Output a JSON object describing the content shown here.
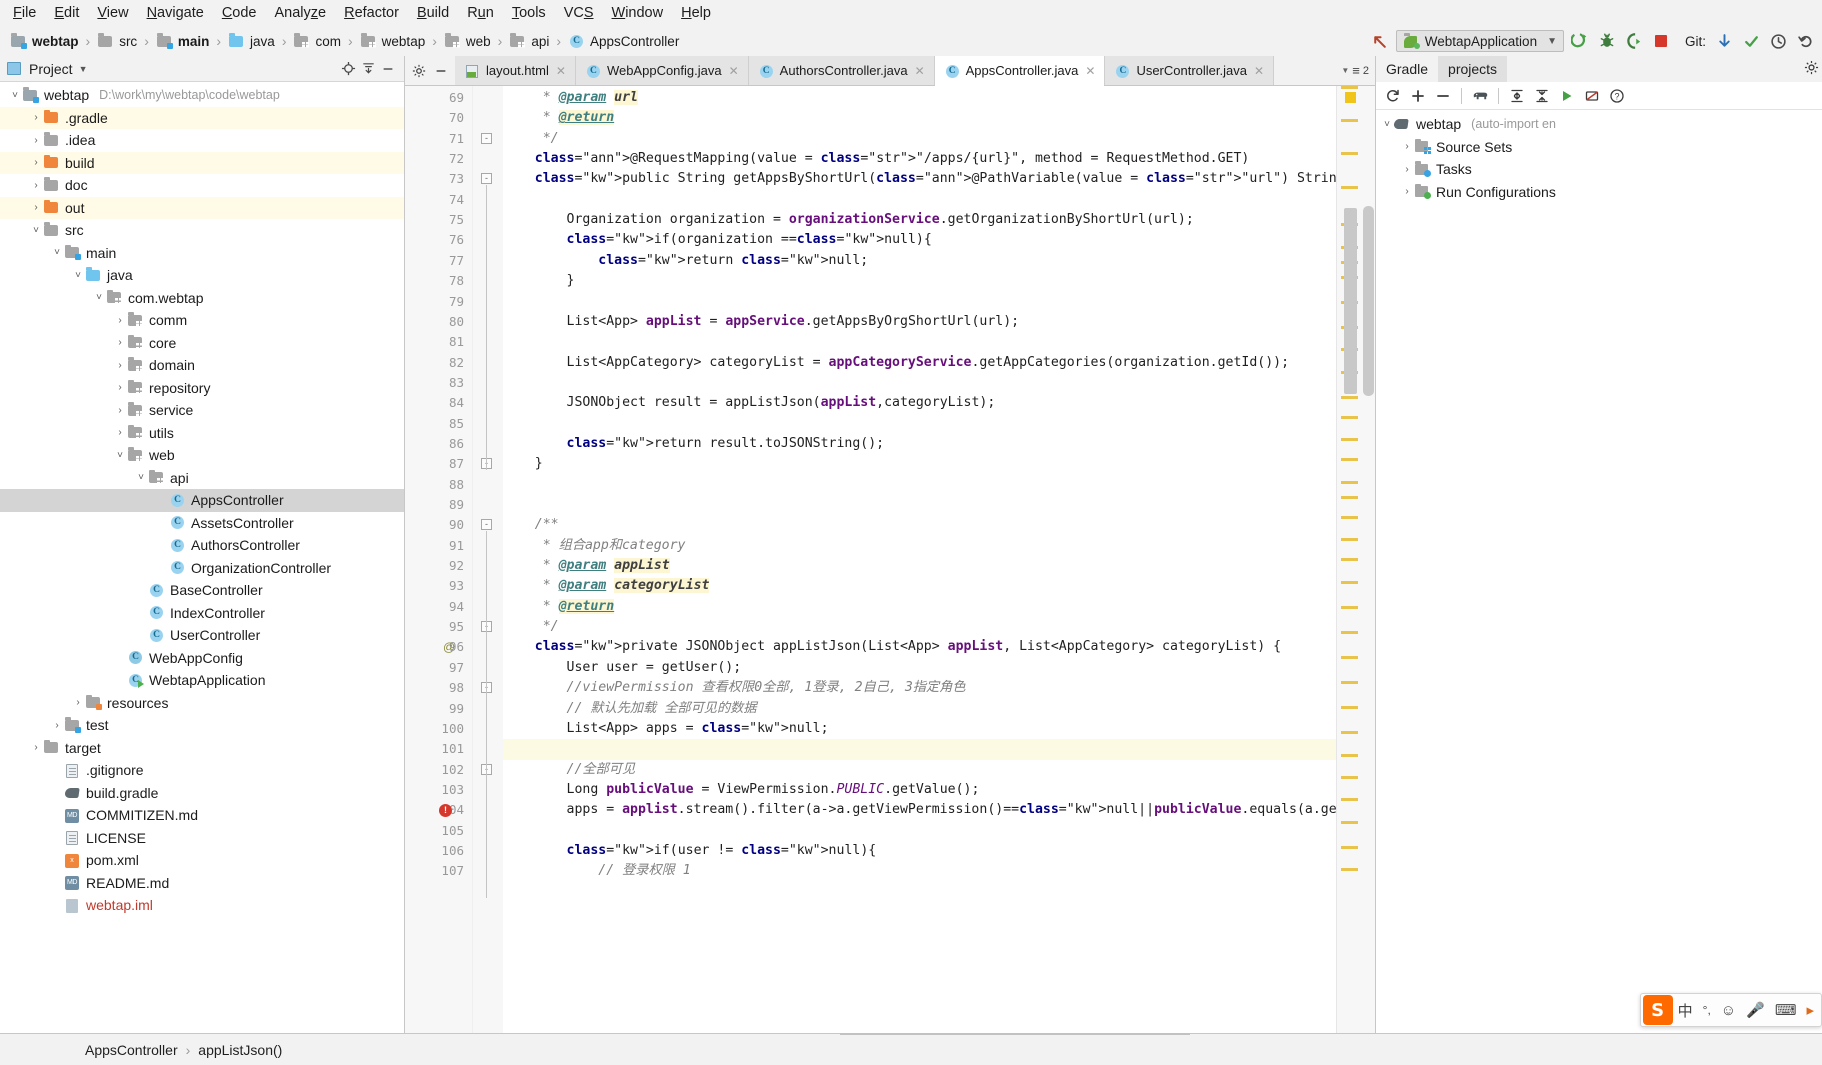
{
  "menu": {
    "items": [
      {
        "label": "File",
        "mnemonic": "F"
      },
      {
        "label": "Edit",
        "mnemonic": "E"
      },
      {
        "label": "View",
        "mnemonic": "V"
      },
      {
        "label": "Navigate",
        "mnemonic": "N"
      },
      {
        "label": "Code",
        "mnemonic": "C"
      },
      {
        "label": "Analyze",
        "mnemonic": "z"
      },
      {
        "label": "Refactor",
        "mnemonic": "R"
      },
      {
        "label": "Build",
        "mnemonic": "B"
      },
      {
        "label": "Run",
        "mnemonic": "u"
      },
      {
        "label": "Tools",
        "mnemonic": "T"
      },
      {
        "label": "VCS",
        "mnemonic": "S"
      },
      {
        "label": "Window",
        "mnemonic": "W"
      },
      {
        "label": "Help",
        "mnemonic": "H"
      }
    ]
  },
  "breadcrumb": {
    "items": [
      {
        "label": "webtap",
        "icon": "module-icon",
        "bold": true
      },
      {
        "label": "src",
        "icon": "folder-icon",
        "bold": false
      },
      {
        "label": "main",
        "icon": "source-folder-icon",
        "bold": true
      },
      {
        "label": "java",
        "icon": "java-folder-icon",
        "bold": false
      },
      {
        "label": "com",
        "icon": "package-icon",
        "bold": false
      },
      {
        "label": "webtap",
        "icon": "package-icon",
        "bold": false
      },
      {
        "label": "web",
        "icon": "package-icon",
        "bold": false
      },
      {
        "label": "api",
        "icon": "package-icon",
        "bold": false
      },
      {
        "label": "AppsController",
        "icon": "class-icon",
        "bold": false
      }
    ]
  },
  "toolbar": {
    "back_icon": "arrow-up-left-icon",
    "run_config": "WebtapApplication",
    "run_config_chevron": "chevron-down-icon",
    "run_icon": "run-icon",
    "debug_icon": "debug-icon",
    "run_coverage_icon": "run-with-coverage-icon",
    "stop_icon": "stop-icon",
    "git_label": "Git:",
    "git_update_icon": "update-project-icon",
    "git_commit_icon": "commit-icon",
    "git_history_icon": "history-icon",
    "git_rollback_icon": "rollback-icon"
  },
  "project_panel": {
    "title": "Project",
    "title_chevron": "chevron-down-icon",
    "locate_icon": "locate-icon",
    "collapse_icon": "collapse-all-icon",
    "hide_icon": "hide-icon",
    "tree": [
      {
        "label": "webtap",
        "path": "D:\\work\\my\\webtap\\code\\webtap",
        "indent": 0,
        "arrow": "expanded",
        "icon": "module-icon",
        "bold": false,
        "state": "normal"
      },
      {
        "label": ".gradle",
        "indent": 1,
        "arrow": "collapsed",
        "icon": "folder-orange-icon",
        "state": "modified"
      },
      {
        "label": ".idea",
        "indent": 1,
        "arrow": "collapsed",
        "icon": "folder-icon",
        "state": "normal"
      },
      {
        "label": "build",
        "indent": 1,
        "arrow": "collapsed",
        "icon": "folder-orange-icon",
        "state": "modified"
      },
      {
        "label": "doc",
        "indent": 1,
        "arrow": "collapsed",
        "icon": "folder-icon",
        "state": "normal"
      },
      {
        "label": "out",
        "indent": 1,
        "arrow": "collapsed",
        "icon": "folder-orange-icon",
        "state": "modified"
      },
      {
        "label": "src",
        "indent": 1,
        "arrow": "expanded",
        "icon": "folder-icon",
        "state": "normal"
      },
      {
        "label": "main",
        "indent": 2,
        "arrow": "expanded",
        "icon": "source-folder-icon",
        "state": "normal"
      },
      {
        "label": "java",
        "indent": 3,
        "arrow": "expanded",
        "icon": "java-folder-icon",
        "state": "normal"
      },
      {
        "label": "com.webtap",
        "indent": 4,
        "arrow": "expanded",
        "icon": "package-icon",
        "state": "normal"
      },
      {
        "label": "comm",
        "indent": 5,
        "arrow": "collapsed",
        "icon": "package-icon",
        "state": "normal"
      },
      {
        "label": "core",
        "indent": 5,
        "arrow": "collapsed",
        "icon": "package-icon",
        "state": "normal"
      },
      {
        "label": "domain",
        "indent": 5,
        "arrow": "collapsed",
        "icon": "package-icon",
        "state": "normal"
      },
      {
        "label": "repository",
        "indent": 5,
        "arrow": "collapsed",
        "icon": "package-icon",
        "state": "normal"
      },
      {
        "label": "service",
        "indent": 5,
        "arrow": "collapsed",
        "icon": "package-icon",
        "state": "normal"
      },
      {
        "label": "utils",
        "indent": 5,
        "arrow": "collapsed",
        "icon": "package-icon",
        "state": "normal"
      },
      {
        "label": "web",
        "indent": 5,
        "arrow": "expanded",
        "icon": "package-icon",
        "state": "normal"
      },
      {
        "label": "api",
        "indent": 6,
        "arrow": "expanded",
        "icon": "package-icon",
        "state": "normal"
      },
      {
        "label": "AppsController",
        "indent": 7,
        "arrow": "none",
        "icon": "class-icon",
        "state": "selected"
      },
      {
        "label": "AssetsController",
        "indent": 7,
        "arrow": "none",
        "icon": "class-icon",
        "state": "normal"
      },
      {
        "label": "AuthorsController",
        "indent": 7,
        "arrow": "none",
        "icon": "class-icon",
        "state": "normal"
      },
      {
        "label": "OrganizationController",
        "indent": 7,
        "arrow": "none",
        "icon": "class-icon",
        "state": "normal"
      },
      {
        "label": "BaseController",
        "indent": 6,
        "arrow": "none",
        "icon": "class-icon",
        "state": "normal"
      },
      {
        "label": "IndexController",
        "indent": 6,
        "arrow": "none",
        "icon": "class-icon",
        "state": "normal"
      },
      {
        "label": "UserController",
        "indent": 6,
        "arrow": "none",
        "icon": "class-icon",
        "state": "normal"
      },
      {
        "label": "WebAppConfig",
        "indent": 5,
        "arrow": "none",
        "icon": "config-class-icon",
        "state": "normal"
      },
      {
        "label": "WebtapApplication",
        "indent": 5,
        "arrow": "none",
        "icon": "runnable-class-icon",
        "state": "normal"
      },
      {
        "label": "resources",
        "indent": 3,
        "arrow": "collapsed",
        "icon": "resources-folder-icon",
        "state": "normal"
      },
      {
        "label": "test",
        "indent": 2,
        "arrow": "collapsed",
        "icon": "test-folder-icon",
        "state": "normal"
      },
      {
        "label": "target",
        "indent": 1,
        "arrow": "collapsed",
        "icon": "folder-icon",
        "state": "normal"
      },
      {
        "label": ".gitignore",
        "indent": 2,
        "arrow": "none",
        "icon": "file-icon",
        "state": "normal"
      },
      {
        "label": "build.gradle",
        "indent": 2,
        "arrow": "none",
        "icon": "gradle-file-icon",
        "state": "normal"
      },
      {
        "label": "COMMITIZEN.md",
        "indent": 2,
        "arrow": "none",
        "icon": "markdown-icon",
        "state": "normal"
      },
      {
        "label": "LICENSE",
        "indent": 2,
        "arrow": "none",
        "icon": "file-icon",
        "state": "normal"
      },
      {
        "label": "pom.xml",
        "indent": 2,
        "arrow": "none",
        "icon": "xml-icon",
        "state": "normal"
      },
      {
        "label": "README.md",
        "indent": 2,
        "arrow": "none",
        "icon": "markdown-icon",
        "state": "normal"
      },
      {
        "label": "webtap.iml",
        "indent": 2,
        "arrow": "none",
        "icon": "iml-icon",
        "state": "red"
      }
    ]
  },
  "editor": {
    "settings_icon": "gear-icon",
    "hide_icon": "minimize-icon",
    "tabs": [
      {
        "label": "layout.html",
        "icon": "html-file-icon",
        "active": false,
        "close_icon": "close-icon"
      },
      {
        "label": "WebAppConfig.java",
        "icon": "class-icon",
        "active": false,
        "close_icon": "close-icon"
      },
      {
        "label": "AuthorsController.java",
        "icon": "class-icon",
        "active": false,
        "close_icon": "close-icon"
      },
      {
        "label": "AppsController.java",
        "icon": "class-icon",
        "active": true,
        "close_icon": "close-icon"
      },
      {
        "label": "UserController.java",
        "icon": "class-icon",
        "active": false,
        "close_icon": "close-icon"
      }
    ],
    "inspection_count": "2",
    "inspection_icon": "inspections-widget-icon",
    "first_line_number": 69,
    "lines": [
      {
        "n": 69,
        "indent": 0
      },
      {
        "n": 70,
        "indent": 0
      },
      {
        "n": 71,
        "indent": 0
      },
      {
        "n": 72,
        "indent": 0
      },
      {
        "n": 73,
        "indent": 0
      },
      {
        "n": 74,
        "indent": 0
      },
      {
        "n": 75,
        "indent": 0
      },
      {
        "n": 76,
        "indent": 0
      },
      {
        "n": 77,
        "indent": 0
      },
      {
        "n": 78,
        "indent": 0
      },
      {
        "n": 79,
        "indent": 0
      },
      {
        "n": 80,
        "indent": 0
      },
      {
        "n": 81,
        "indent": 0
      },
      {
        "n": 82,
        "indent": 0
      },
      {
        "n": 83,
        "indent": 0
      },
      {
        "n": 84,
        "indent": 0
      },
      {
        "n": 85,
        "indent": 0
      },
      {
        "n": 86,
        "indent": 0
      },
      {
        "n": 87,
        "indent": 0
      },
      {
        "n": 88,
        "indent": 0
      },
      {
        "n": 89,
        "indent": 0
      },
      {
        "n": 90,
        "indent": 0
      },
      {
        "n": 91,
        "indent": 0
      },
      {
        "n": 92,
        "indent": 0
      },
      {
        "n": 93,
        "indent": 0
      },
      {
        "n": 94,
        "indent": 0
      },
      {
        "n": 95,
        "indent": 0
      },
      {
        "n": 96,
        "indent": 0
      },
      {
        "n": 97,
        "indent": 0
      },
      {
        "n": 98,
        "indent": 0
      },
      {
        "n": 99,
        "indent": 0
      },
      {
        "n": 100,
        "indent": 0
      },
      {
        "n": 101,
        "indent": 0
      },
      {
        "n": 102,
        "indent": 0
      },
      {
        "n": 103,
        "indent": 0
      },
      {
        "n": 104,
        "indent": 0
      },
      {
        "n": 105,
        "indent": 0
      },
      {
        "n": 106,
        "indent": 0
      },
      {
        "n": 107,
        "indent": 0
      }
    ],
    "source_text": [
      "     * @param url",
      "     * @return",
      "     */",
      "    @RequestMapping(value = \"/apps/{url}\", method = RequestMethod.GET)",
      "    public String getAppsByShortUrl(@PathVariable(value = \"url\") String url) {",
      "",
      "        Organization organization = organizationService.getOrganizationByShortUrl(url);",
      "        if(organization ==null){",
      "            return null;",
      "        }",
      "",
      "        List<App> appList = appService.getAppsByOrgShortUrl(url);",
      "",
      "        List<AppCategory> categoryList = appCategoryService.getAppCategories(organization.getId());",
      "",
      "        JSONObject result = appListJson(appList,categoryList);",
      "",
      "        return result.toJSONString();",
      "    }",
      "",
      "",
      "    /**",
      "     * 组合app和category",
      "     * @param appList",
      "     * @param categoryList",
      "     * @return",
      "     */",
      "    private JSONObject appListJson(List<App> appList, List<AppCategory> categoryList) {",
      "        User user = getUser();",
      "        //viewPermission 查看权限0全部, 1登录, 2自己, 3指定角色",
      "        // 默认先加载 全部可见的数据",
      "        List<App> apps = null;",
      "",
      "        //全部可见",
      "        Long publicValue = ViewPermission.PUBLIC.getValue();",
      "        apps = applist.stream().filter(a->a.getViewPermission()==null||publicValue.equals(a.getViewPermission())).collect(Collect",
      "",
      "        if(user != null){",
      "            // 登录权限 1"
    ],
    "caret_line": 101,
    "error_icon": "error-stripe-icon",
    "annotation_icon": "annotation-gutter-icon"
  },
  "gradle_panel": {
    "tabs": [
      {
        "label": "Gradle",
        "active": false
      },
      {
        "label": "projects",
        "active": true
      }
    ],
    "settings_icon": "gear-icon",
    "toolbar_icons": [
      "refresh-icon",
      "add-icon",
      "remove-icon",
      "gradle-elephant-icon",
      "expand-all-icon",
      "collapse-all-icon",
      "run-task-icon",
      "toggle-offline-icon",
      "help-icon"
    ],
    "tree": [
      {
        "label": "webtap",
        "suffix": "(auto-import en",
        "indent": 0,
        "arrow": "expanded",
        "icon": "gradle-elephant-icon"
      },
      {
        "label": "Source Sets",
        "indent": 1,
        "arrow": "collapsed",
        "icon": "source-sets-icon"
      },
      {
        "label": "Tasks",
        "indent": 1,
        "arrow": "collapsed",
        "icon": "tasks-icon"
      },
      {
        "label": "Run Configurations",
        "indent": 1,
        "arrow": "collapsed",
        "icon": "run-configurations-icon"
      }
    ]
  },
  "ime": {
    "logo": "S",
    "mode_label": "中",
    "punct_icon": "punctuation-icon",
    "emoji_icon": "emoji-icon",
    "voice_icon": "microphone-icon",
    "keyboard_icon": "keyboard-icon",
    "more_icon": "more-icon"
  },
  "status_bar": {
    "breadcrumb": [
      {
        "label": "AppsController"
      },
      {
        "label": "appListJson()"
      }
    ],
    "separator": "›"
  }
}
